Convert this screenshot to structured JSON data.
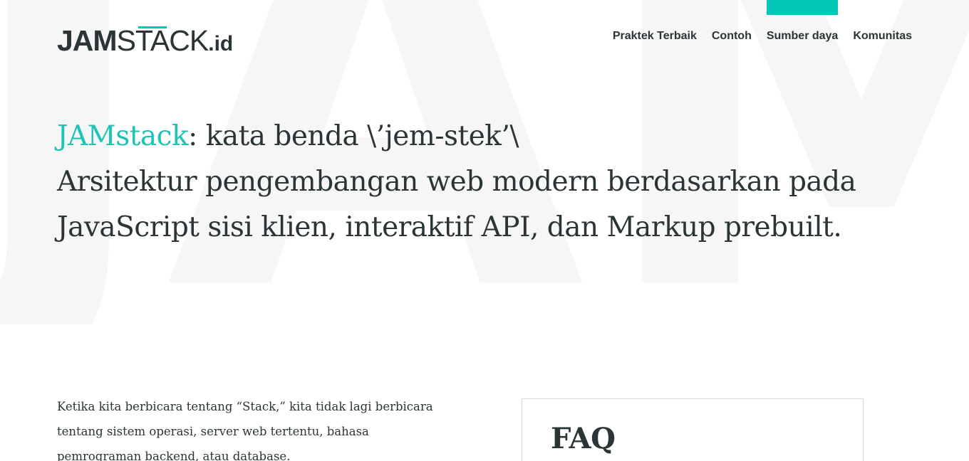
{
  "background": {
    "letters": "JAM"
  },
  "logo": {
    "part1": "JAM",
    "part2": "STACK",
    "part3": ".id"
  },
  "nav": {
    "items": [
      {
        "label": "Praktek Terbaik"
      },
      {
        "label": "Contoh"
      },
      {
        "label": "Sumber daya"
      },
      {
        "label": "Komunitas"
      }
    ]
  },
  "hero": {
    "term": "JAMstack",
    "definition": ": kata benda \\’jem-stek’\\",
    "description_line1": "Arsitektur pengembangan web modern berdasarkan pada",
    "description_line2": "JavaScript sisi klien, interaktif API, dan Markup prebuilt."
  },
  "intro": {
    "text": "Ketika kita berbicara tentang “Stack,” kita tidak lagi berbicara tentang sistem operasi, server web tertentu, bahasa pemrograman backend, atau database."
  },
  "faq": {
    "title": "FAQ"
  },
  "colors": {
    "accent": "#00c7b7",
    "text": "#2b3436",
    "bg_letters": "#f6f6f6"
  }
}
